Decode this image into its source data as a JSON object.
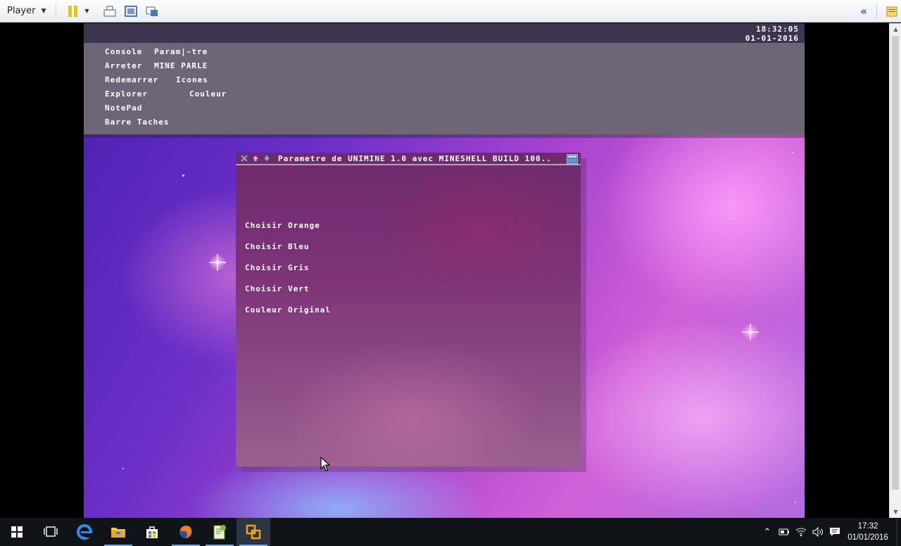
{
  "player": {
    "menu_label": "Player"
  },
  "guest": {
    "clock": {
      "time": "18:32:05",
      "date": "01-01-2016"
    },
    "menu": {
      "console": "Console",
      "parametre": "Param|-tre",
      "arreter": "Arreter",
      "mine_parle": "MINE PARLE",
      "redemarrer": "Redemarrer",
      "icones": "Icones",
      "explorer": "Explorer",
      "couleur": "Couleur",
      "notepad": "NotePad",
      "barre_taches": "Barre Taches"
    },
    "window": {
      "title": "Parametre de UNIMINE 1.0 avec MINESHELL BUILD 100..",
      "options": [
        "Choisir Orange",
        "Choisir Bleu",
        "Choisir Gris",
        "Choisir Vert",
        "Couleur Original"
      ]
    }
  },
  "taskbar": {
    "clock_time": "17:32",
    "clock_date": "01/01/2016",
    "apps": [
      "start-icon",
      "task-view-icon",
      "edge-icon",
      "file-explorer-icon",
      "store-icon",
      "firefox-icon",
      "notepad-plus-plus-icon",
      "vmware-player-icon"
    ]
  },
  "colors": {
    "menu_panel": "#6e6577",
    "window_body": "#7d3478",
    "taskbar": "#101318",
    "accent_running": "#7aa7d8"
  }
}
